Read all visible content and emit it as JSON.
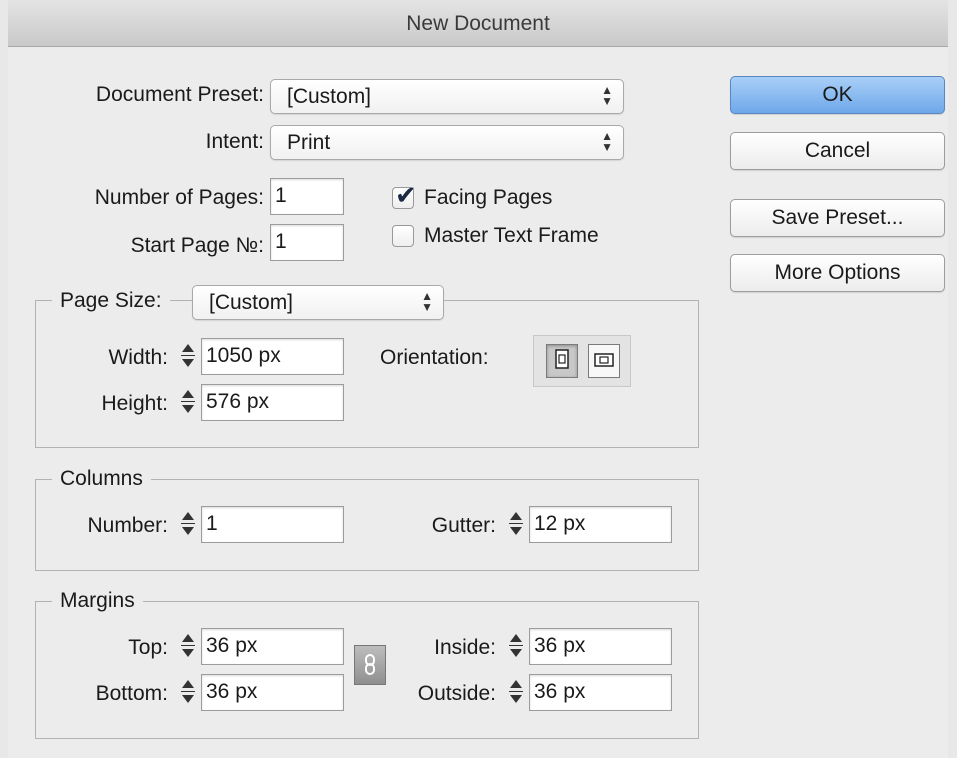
{
  "window": {
    "title": "New Document"
  },
  "document_preset": {
    "label": "Document Preset:",
    "value": "[Custom]"
  },
  "intent": {
    "label": "Intent:",
    "value": "Print"
  },
  "number_of_pages": {
    "label": "Number of Pages:",
    "value": "1"
  },
  "start_page": {
    "label": "Start Page №:",
    "value": "1"
  },
  "facing_pages": {
    "label": "Facing Pages",
    "checked": true
  },
  "master_text_frame": {
    "label": "Master Text Frame",
    "checked": false
  },
  "page_size": {
    "label": "Page Size:",
    "value": "[Custom]",
    "width": {
      "label": "Width:",
      "value": "1050 px"
    },
    "height": {
      "label": "Height:",
      "value": "576 px"
    },
    "orientation": {
      "label": "Orientation:",
      "selected": "portrait"
    }
  },
  "columns": {
    "title": "Columns",
    "number": {
      "label": "Number:",
      "value": "1"
    },
    "gutter": {
      "label": "Gutter:",
      "value": "12 px"
    }
  },
  "margins": {
    "title": "Margins",
    "top": {
      "label": "Top:",
      "value": "36 px"
    },
    "bottom": {
      "label": "Bottom:",
      "value": "36 px"
    },
    "inside": {
      "label": "Inside:",
      "value": "36 px"
    },
    "outside": {
      "label": "Outside:",
      "value": "36 px"
    },
    "link_icon": "chain-link-icon"
  },
  "buttons": {
    "ok": "OK",
    "cancel": "Cancel",
    "save_preset": "Save Preset...",
    "more_options": "More Options"
  },
  "colors": {
    "primary_button": "#7fb3ee",
    "background": "#ececec"
  }
}
